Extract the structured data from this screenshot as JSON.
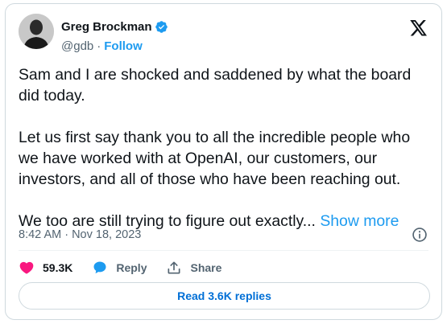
{
  "author": {
    "display_name": "Greg Brockman",
    "handle": "@gdb",
    "separator": "·",
    "follow_label": "Follow"
  },
  "tweet": {
    "paragraphs": [
      "Sam and I are shocked and saddened by what the board did today.",
      "Let us first say thank you to all the incredible people who we have worked with at OpenAI, our customers, our investors, and all of those who have been reaching out.",
      "We too are still trying to figure out exactly..."
    ],
    "show_more": "Show more",
    "timestamp": "8:42 AM · Nov 18, 2023"
  },
  "actions": {
    "likes": "59.3K",
    "reply": "Reply",
    "share": "Share"
  },
  "read_replies": "Read 3.6K replies",
  "colors": {
    "accent": "#1d9bf0",
    "like": "#f91880",
    "link_dark": "#006fd6"
  }
}
